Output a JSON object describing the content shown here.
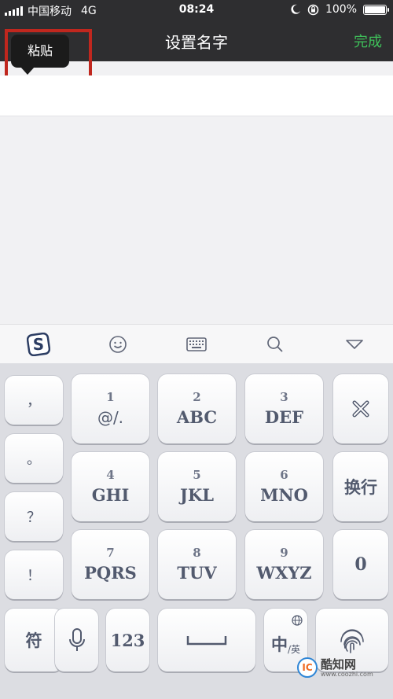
{
  "status_bar": {
    "carrier": "中国移动",
    "network": "4G",
    "time": "08:24",
    "battery": "100%",
    "icons": [
      "signal-icon",
      "moon-icon",
      "orientation-lock-icon",
      "battery-icon"
    ]
  },
  "nav": {
    "title": "设置名字",
    "done": "完成"
  },
  "tooltip": {
    "paste": "粘贴"
  },
  "input": {
    "value": ""
  },
  "toolbar": {
    "icons": [
      "sogou-logo-icon",
      "emoji-icon",
      "keyboard-icon",
      "search-icon",
      "collapse-icon"
    ]
  },
  "keys": {
    "punct": [
      "，",
      "。",
      "？",
      "！"
    ],
    "k1": {
      "num": "1",
      "letters": "@/."
    },
    "k2": {
      "num": "2",
      "letters": "ABC"
    },
    "k3": {
      "num": "3",
      "letters": "DEF"
    },
    "k4": {
      "num": "4",
      "letters": "GHI"
    },
    "k5": {
      "num": "5",
      "letters": "JKL"
    },
    "k6": {
      "num": "6",
      "letters": "MNO"
    },
    "k7": {
      "num": "7",
      "letters": "PQRS"
    },
    "k8": {
      "num": "8",
      "letters": "TUV"
    },
    "k9": {
      "num": "9",
      "letters": "WXYZ"
    },
    "enter": "换行",
    "zero": "0",
    "symbol": "符",
    "num123": "123",
    "lang_main": "中",
    "lang_sub": "/英"
  },
  "watermark": {
    "name": "酷知网",
    "url": "www.coozhi.com",
    "logo": "IC"
  },
  "colors": {
    "accent": "#3fc15a",
    "highlight": "#c0271e",
    "nav_bg": "#2e2e30"
  }
}
